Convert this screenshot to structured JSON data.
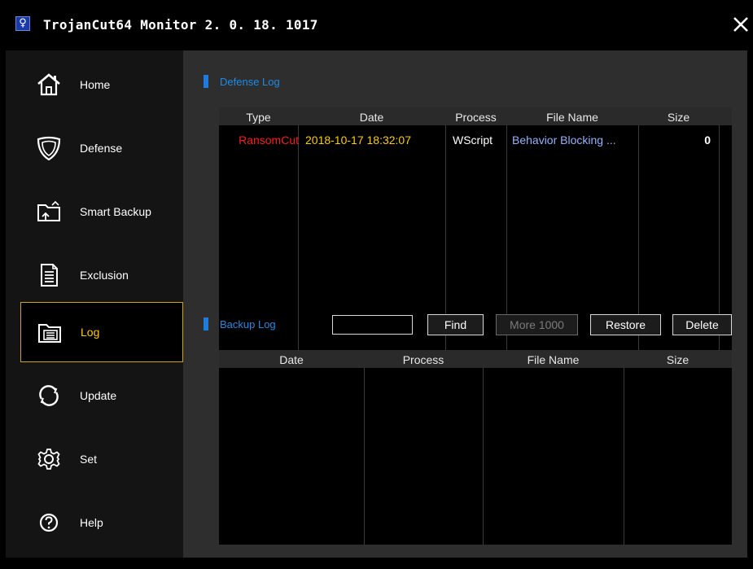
{
  "window": {
    "title": "TrojanCut64 Monitor 2. 0. 18. 1017"
  },
  "sidebar": {
    "items": [
      {
        "label": "Home",
        "icon": "home-icon"
      },
      {
        "label": "Defense",
        "icon": "shield-icon"
      },
      {
        "label": "Smart Backup",
        "icon": "folder-backup-icon"
      },
      {
        "label": "Exclusion",
        "icon": "document-icon"
      },
      {
        "label": "Log",
        "icon": "log-folder-icon",
        "active": true
      },
      {
        "label": "Update",
        "icon": "update-icon"
      },
      {
        "label": "Set",
        "icon": "gear-icon"
      },
      {
        "label": "Help",
        "icon": "help-icon"
      }
    ]
  },
  "defense_log": {
    "title": "Defense Log",
    "columns": [
      "Type",
      "Date",
      "Process",
      "File Name",
      "Size"
    ],
    "rows": [
      {
        "type": "RansomCut",
        "date": "2018-10-17 18:32:07",
        "process": "WScript",
        "file_name": "Behavior Blocking ...",
        "size": "0"
      }
    ]
  },
  "backup_log": {
    "title": "Backup Log",
    "search_value": "",
    "buttons": {
      "find": "Find",
      "more": "More 1000",
      "restore": "Restore",
      "delete": "Delete"
    },
    "columns": [
      "Date",
      "Process",
      "File Name",
      "Size"
    ],
    "rows": []
  },
  "colors": {
    "accent_blue": "#1f8ae6",
    "active_border": "#c9a227",
    "ransom_red": "#ff1a1a",
    "date_yellow": "#ffcc00",
    "filename_blue": "#8fb4ff"
  }
}
